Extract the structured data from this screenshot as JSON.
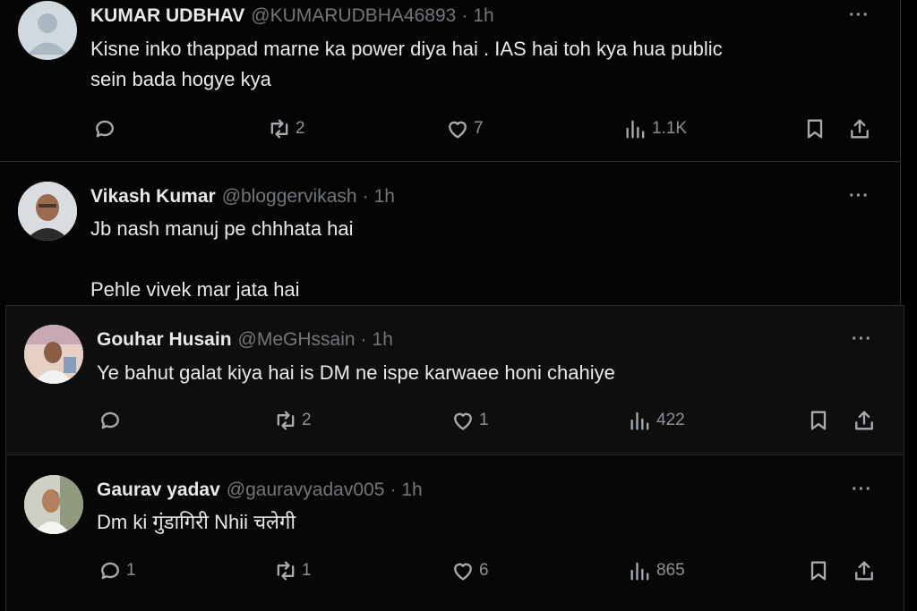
{
  "posts": [
    {
      "name": "KUMAR UDBHAV",
      "handle": "@KUMARUDBHA46893",
      "time": "1h",
      "text": "Kisne inko thappad marne ka  power diya hai . IAS hai toh kya hua public\nsein bada hogye kya",
      "replies": "",
      "reposts": "2",
      "likes": "7",
      "views": "1.1K"
    },
    {
      "name": "Vikash Kumar",
      "handle": "@bloggervikash",
      "time": "1h",
      "text": "Jb nash manuj pe chhhata hai\n\nPehle vivek mar jata hai"
    },
    {
      "name": "Gouhar Husain",
      "handle": "@MeGHssain",
      "time": "1h",
      "text": "Ye bahut galat kiya hai is DM ne ispe karwaee honi chahiye",
      "replies": "",
      "reposts": "2",
      "likes": "1",
      "views": "422"
    },
    {
      "name": "Gaurav yadav",
      "handle": "@gauravyadav005",
      "time": "1h",
      "text": "Dm ki गुंडागिरी Nhii चलेगी",
      "replies": "1",
      "reposts": "1",
      "likes": "6",
      "views": "865"
    }
  ],
  "ui": {
    "more": "···",
    "dot": "·"
  },
  "colors": {
    "background": "#000000",
    "text": "#e7e9ea",
    "muted": "#71767b",
    "border": "#2f3336"
  },
  "icons": [
    "reply-icon",
    "repost-icon",
    "like-icon",
    "views-icon",
    "bookmark-icon",
    "share-icon",
    "more-icon"
  ]
}
